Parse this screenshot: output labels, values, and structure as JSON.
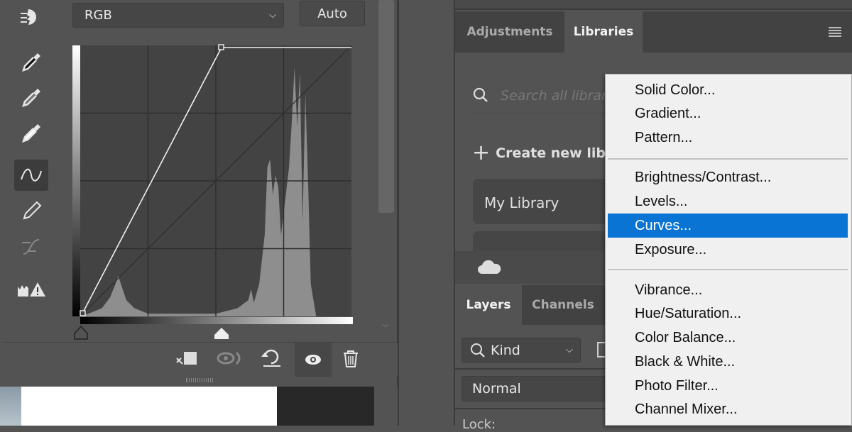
{
  "curves": {
    "channel": "RGB",
    "auto_label": "Auto"
  },
  "tools": [
    "on-image-adjust-icon",
    "black-point-eyedropper-icon",
    "gray-point-eyedropper-icon",
    "white-point-eyedropper-icon",
    "curve-points-icon",
    "pencil-icon",
    "smooth-icon",
    "clipping-warning-icon"
  ],
  "footer_icons": [
    "clip-to-layer-icon",
    "view-previous-icon",
    "reset-icon",
    "visibility-eye-icon",
    "trash-icon"
  ],
  "right_tabs": [
    {
      "label": "Adjustments",
      "active": false
    },
    {
      "label": "Libraries",
      "active": true
    }
  ],
  "libraries": {
    "search_placeholder": "Search all librar",
    "create_label": "Create new libr",
    "library_name": "My Library"
  },
  "layers": {
    "tabs": [
      {
        "label": "Layers",
        "active": true
      },
      {
        "label": "Channels",
        "active": false
      }
    ],
    "filter": "Kind",
    "blend_mode": "Normal",
    "lock_label": "Lock:"
  },
  "menu": {
    "selected": "Curves...",
    "groups": [
      [
        "Solid Color...",
        "Gradient...",
        "Pattern..."
      ],
      [
        "Brightness/Contrast...",
        "Levels...",
        "Curves...",
        "Exposure..."
      ],
      [
        "Vibrance...",
        "Hue/Saturation...",
        "Color Balance...",
        "Black & White...",
        "Photo Filter...",
        "Channel Mixer..."
      ]
    ]
  },
  "colors": {
    "highlight": "#0a74d4",
    "panel": "#535353",
    "menu_bg": "#f0f0f0"
  }
}
